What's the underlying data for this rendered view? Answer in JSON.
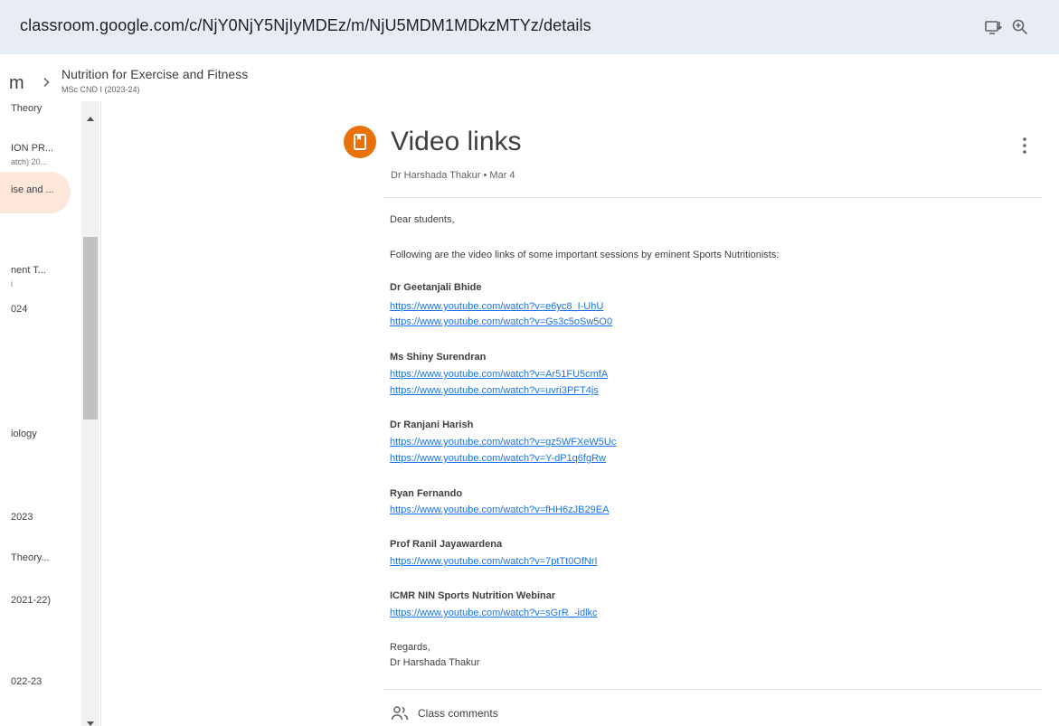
{
  "browser": {
    "url": "classroom.google.com/c/NjY0NjY5NjIyMDEz/m/NjU5MDM1MDkzMTYz/details",
    "icons": [
      "install-app-icon",
      "zoom-icon"
    ]
  },
  "breadcrumb": {
    "prefix": "m",
    "title": "Nutrition for Exercise and Fitness",
    "subtitle": "MSc CND I (2023-24)"
  },
  "sidebar": {
    "items": [
      {
        "label": "Theory"
      },
      {
        "label": "ION PR...",
        "sub": "atch) 20..."
      },
      {
        "label": "ise and ...",
        "active": true
      },
      {
        "label": "nent T...",
        "sub": "i"
      },
      {
        "label": "024"
      },
      {
        "label": "iology"
      },
      {
        "label": "2023"
      },
      {
        "label": "Theory..."
      },
      {
        "label": "2021-22)"
      },
      {
        "label": "022-23"
      }
    ]
  },
  "post": {
    "title": "Video links",
    "author": "Dr Harshada Thakur",
    "date": "Mar 4",
    "greeting": "Dear students,",
    "intro": "Following are the video links of some important sessions by eminent Sports Nutritionists:",
    "sections": [
      {
        "name": "Dr Geetanjali Bhide",
        "links": [
          "https://www.youtube.com/watch?v=e6yc8_I-UhU",
          "https://www.youtube.com/watch?v=Gs3c5oSw5O0"
        ]
      },
      {
        "name": "Ms Shiny Surendran",
        "links": [
          "https://www.youtube.com/watch?v=Ar51FU5cmfA",
          "https://www.youtube.com/watch?v=uvri3PFT4js"
        ]
      },
      {
        "name": "Dr Ranjani Harish",
        "links": [
          "https://www.youtube.com/watch?v=gz5WFXeW5Uc",
          "https://www.youtube.com/watch?v=Y-dP1q6fgRw"
        ]
      },
      {
        "name": "Ryan Fernando",
        "links": [
          "https://www.youtube.com/watch?v=fHH6zJB29EA"
        ]
      },
      {
        "name": "Prof Ranil Jayawardena",
        "links": [
          "https://www.youtube.com/watch?v=7ptTt0OfNrI"
        ]
      },
      {
        "name": "ICMR NIN Sports Nutrition Webinar",
        "links": [
          "https://www.youtube.com/watch?v=sGrR_-idlkc"
        ]
      }
    ],
    "regards": "Regards,",
    "signature": "Dr Harshada Thakur",
    "comments_label": "Class comments"
  },
  "colors": {
    "url_bar_bg": "#e8ecf6",
    "accent": "#e8710a",
    "link": "#1a73e8",
    "active_item_bg": "#fde7db"
  }
}
